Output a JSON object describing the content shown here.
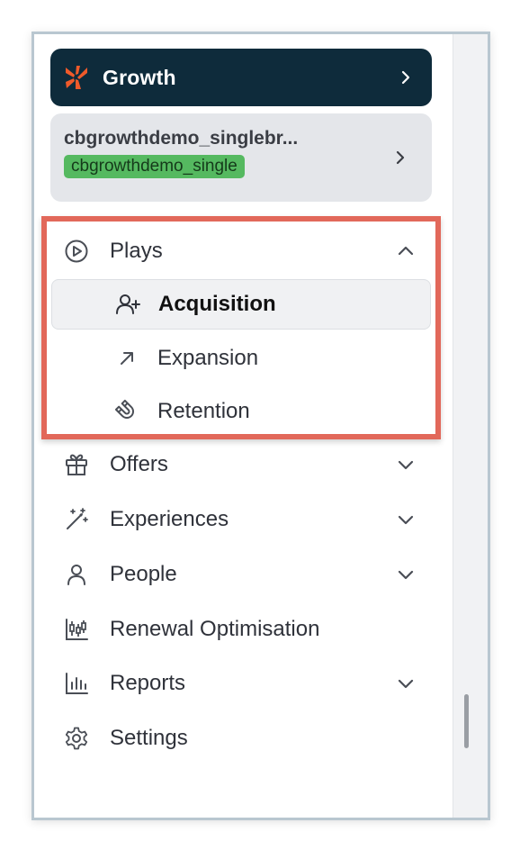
{
  "workspace": {
    "title": "Growth",
    "logo_icon": "growth-logo-icon",
    "color": "#0e2b3b",
    "accent": "#ef5a2a"
  },
  "site": {
    "name": "cbgrowthdemo_singlebr...",
    "badge": "cbgrowthdemo_single",
    "badge_color": "#55b960"
  },
  "nav": {
    "plays": {
      "label": "Plays",
      "icon": "play-circle-icon",
      "expanded": true,
      "children": [
        {
          "label": "Acquisition",
          "icon": "user-plus-icon",
          "active": true
        },
        {
          "label": "Expansion",
          "icon": "arrow-up-right-icon"
        },
        {
          "label": "Retention",
          "icon": "magnet-icon"
        }
      ]
    },
    "items": [
      {
        "label": "Offers",
        "icon": "gift-icon",
        "has_chevron": true
      },
      {
        "label": "Experiences",
        "icon": "magic-wand-icon",
        "has_chevron": true
      },
      {
        "label": "People",
        "icon": "user-icon",
        "has_chevron": true
      },
      {
        "label": "Renewal Optimisation",
        "icon": "candlestick-chart-icon",
        "has_chevron": false
      },
      {
        "label": "Reports",
        "icon": "bar-chart-icon",
        "has_chevron": true
      },
      {
        "label": "Settings",
        "icon": "gear-icon",
        "has_chevron": false
      }
    ]
  },
  "highlight_color": "#e2685a"
}
